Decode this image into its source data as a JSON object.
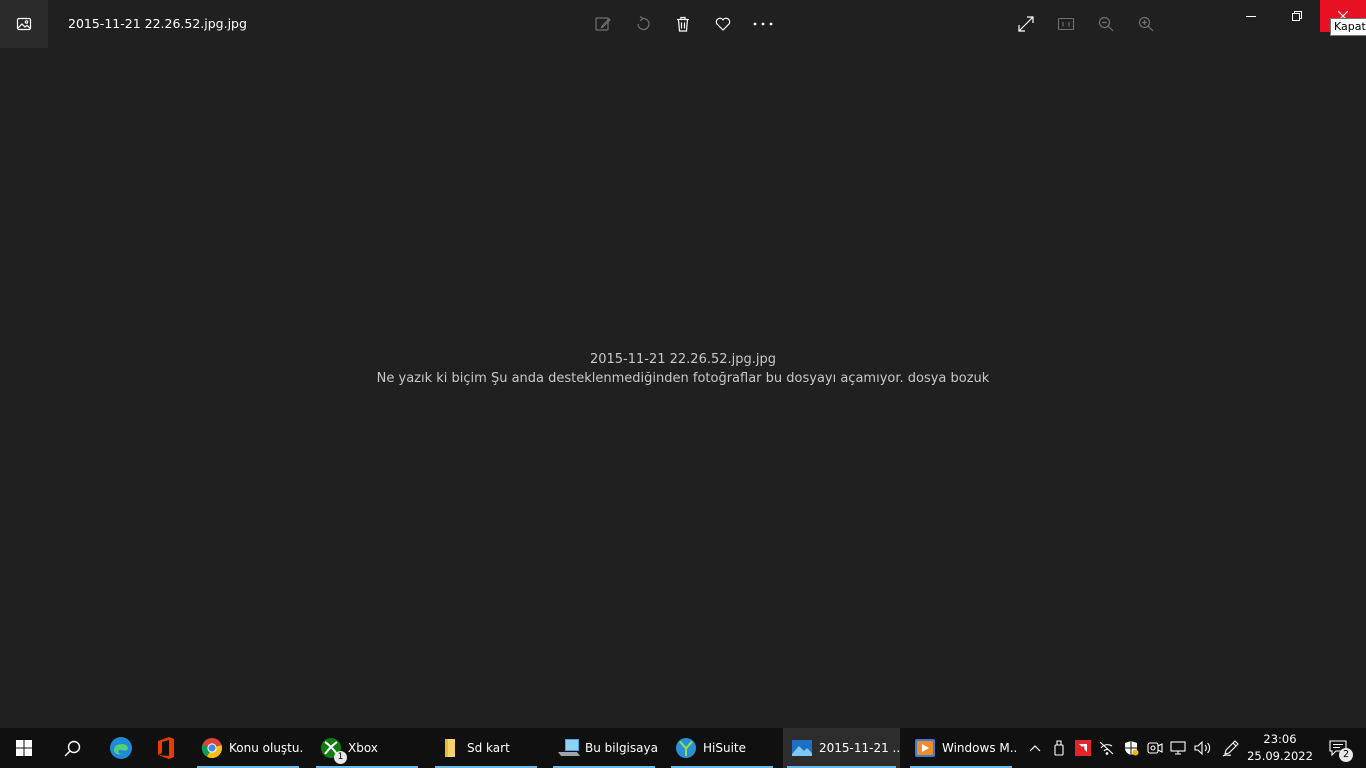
{
  "window": {
    "title": "2015-11-21 22.26.52.jpg.jpg",
    "close_tooltip": "Kapat"
  },
  "toolbar_icons": [
    "edit-icon",
    "rotate-icon",
    "delete-icon",
    "favorite-icon",
    "more-icon",
    "fullscreen-icon",
    "actual-size-icon",
    "zoom-out-icon",
    "zoom-in-icon"
  ],
  "error": {
    "filename": "2015-11-21 22.26.52.jpg.jpg",
    "message": "Ne yazık ki biçim Şu anda desteklenmediğinden fotoğraflar bu dosyayı açamıyor. dosya bozuk"
  },
  "taskbar": {
    "tasks": [
      {
        "label": "Konu oluştu...",
        "icon": "chrome-icon"
      },
      {
        "label": "Xbox",
        "icon": "xbox-icon",
        "badge": "1"
      },
      {
        "label": "Sd kart",
        "icon": "folder-icon"
      },
      {
        "label": "Bu bilgisayar",
        "icon": "computer-icon"
      },
      {
        "label": "HiSuite",
        "icon": "hisuite-icon"
      },
      {
        "label": "2015-11-21 ...",
        "icon": "photos-icon"
      },
      {
        "label": "Windows M...",
        "icon": "media-player-icon"
      }
    ],
    "clock": {
      "time": "23:06",
      "date": "25.09.2022"
    },
    "notification_count": "2"
  },
  "colors": {
    "background": "#202020",
    "taskbar": "#101010",
    "close": "#e81123",
    "accent": "#6fb9e8"
  }
}
